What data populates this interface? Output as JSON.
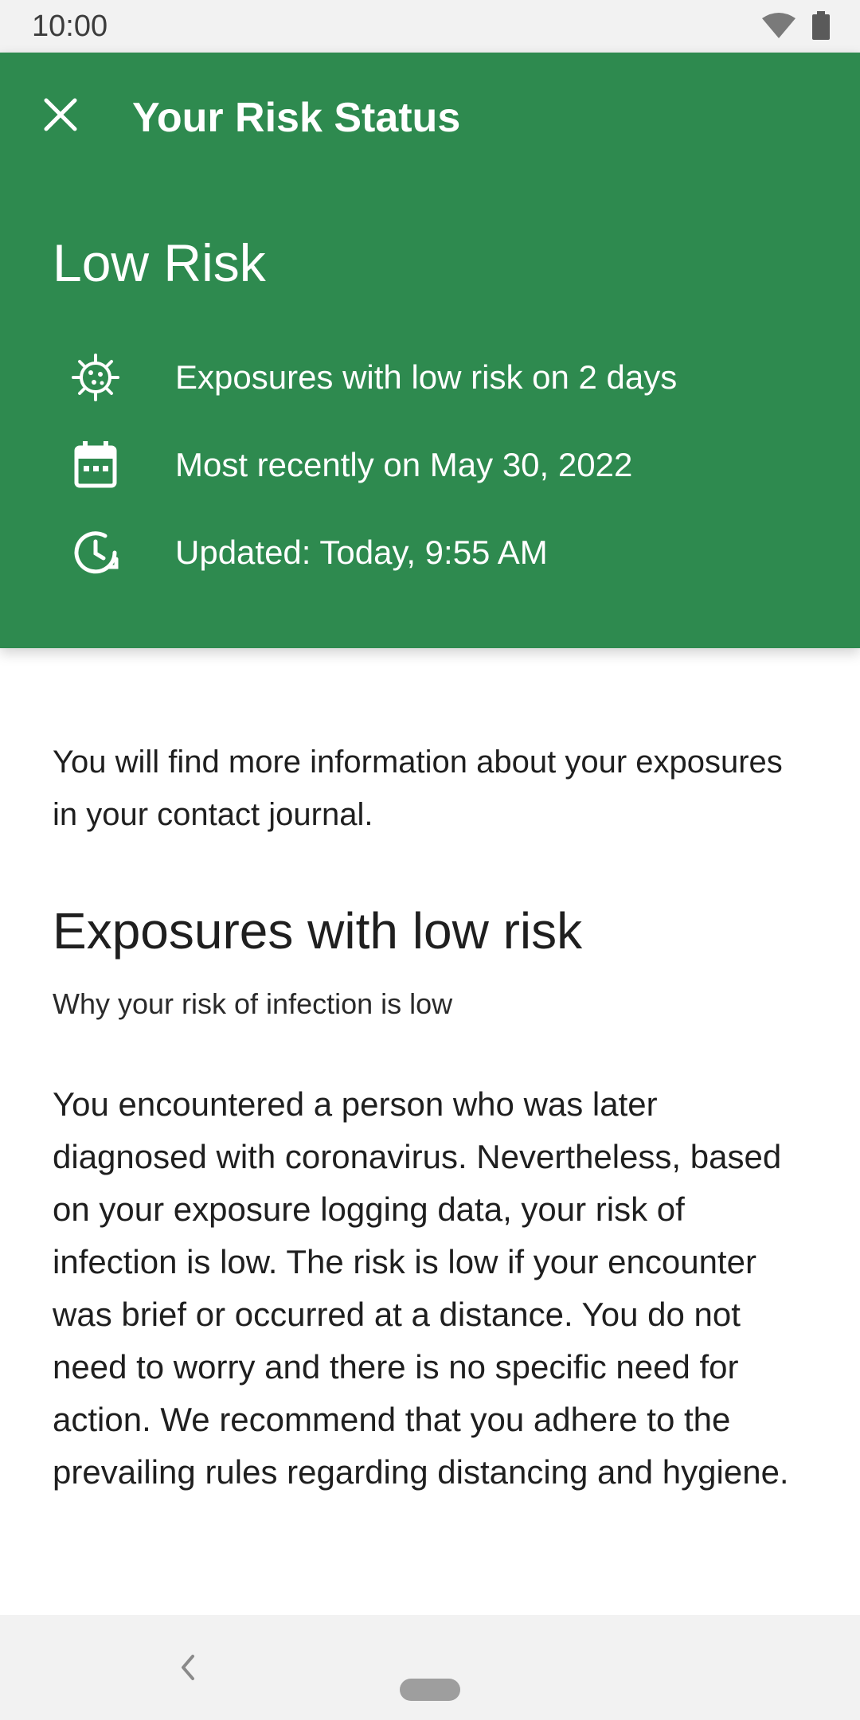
{
  "status_bar": {
    "time": "10:00"
  },
  "header": {
    "title": "Your Risk Status",
    "risk_level": "Low Risk",
    "rows": [
      {
        "icon": "virus-icon",
        "text": "Exposures with low risk on 2 days"
      },
      {
        "icon": "calendar-icon",
        "text": "Most recently on May 30, 2022"
      },
      {
        "icon": "clock-refresh-icon",
        "text": "Updated: Today, 9:55 AM"
      }
    ]
  },
  "content": {
    "intro": "You will find more information about your exposures in your contact journal.",
    "section_title": "Exposures with low risk",
    "section_subtitle": "Why your risk of infection is low",
    "body": "You encountered a person who was later diagnosed with coronavirus. Nevertheless, based on your exposure logging data, your risk of infection is low. The risk is low if your encounter was brief or occurred at a distance. You do not need to worry and there is no specific need for action. We recommend that you adhere to the prevailing rules regarding distancing and hygiene."
  },
  "colors": {
    "header_bg": "#2e8a4f",
    "status_bar_bg": "#f2f2f2"
  }
}
